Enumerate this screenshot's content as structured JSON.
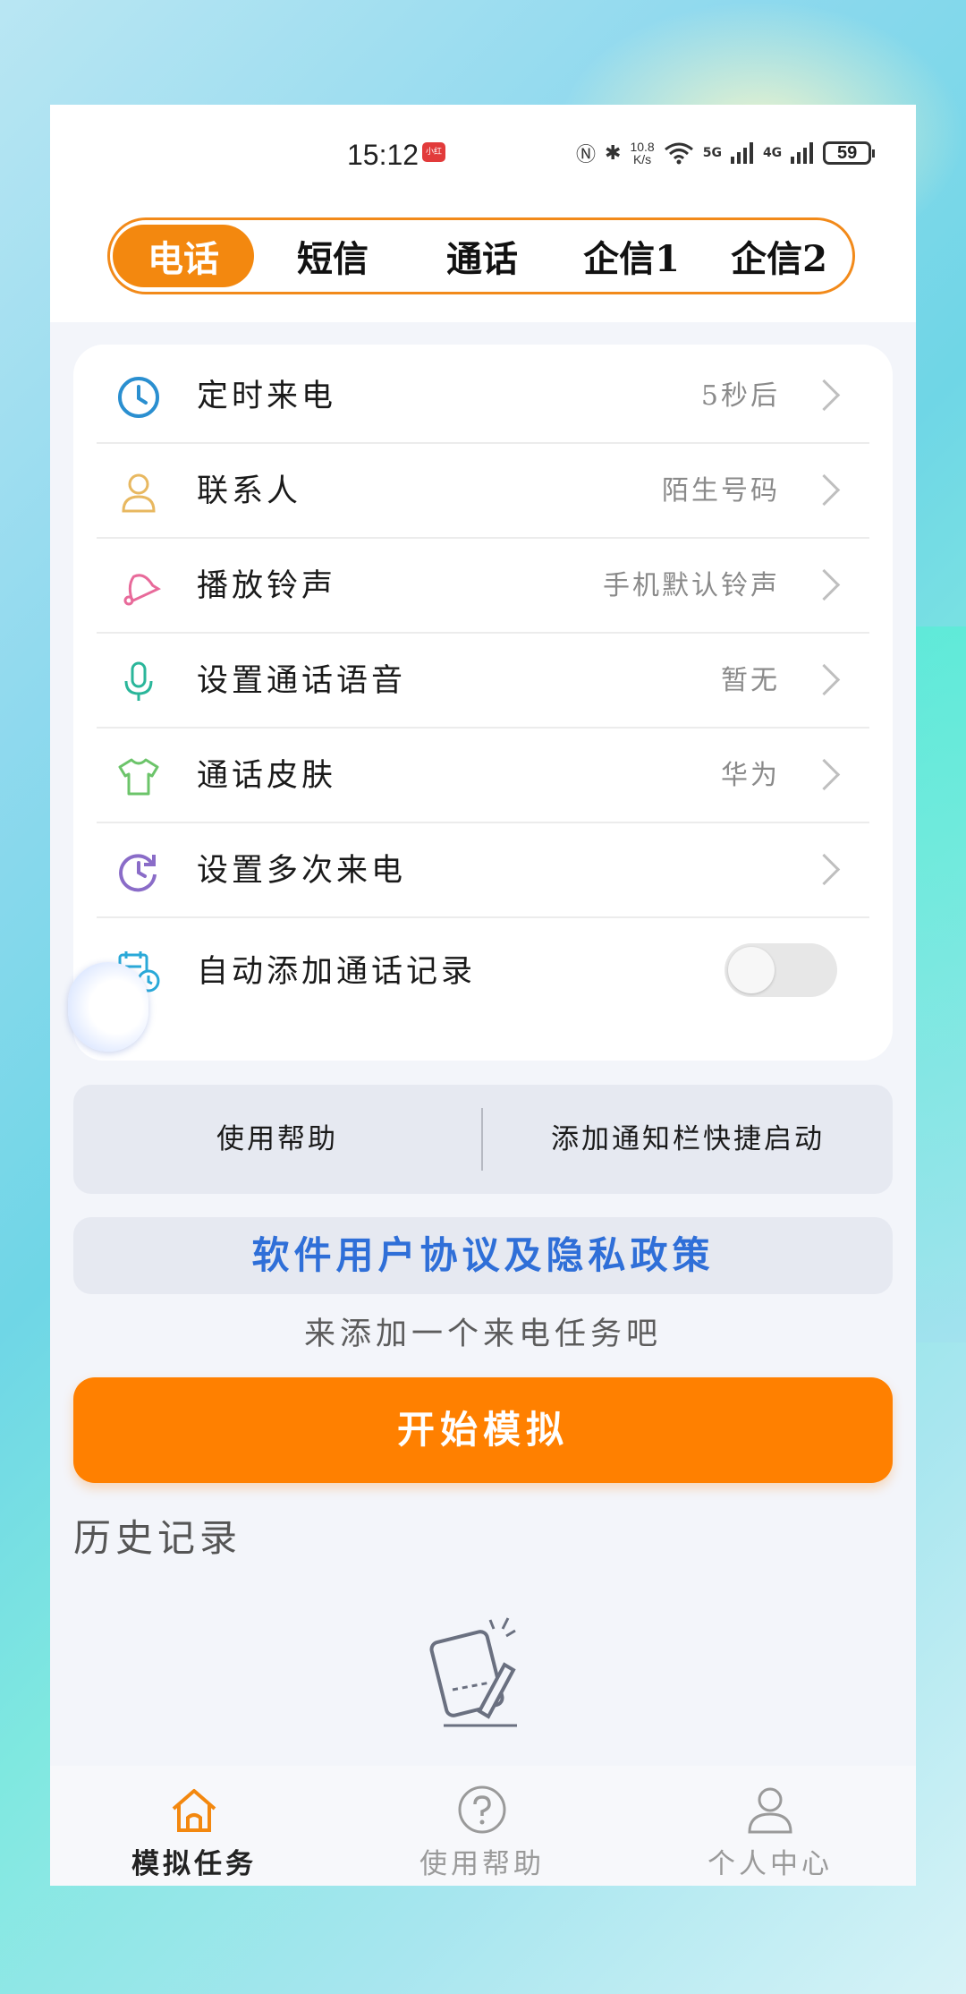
{
  "status_bar": {
    "time": "15:12",
    "badge": "小红书",
    "speed_top": "10.8",
    "speed_unit": "K/s",
    "network_1": "5G",
    "network_2": "4G",
    "battery": "59"
  },
  "tabs": [
    {
      "label": "电话",
      "active": true
    },
    {
      "label": "短信",
      "active": false
    },
    {
      "label": "通话",
      "active": false
    },
    {
      "label": "企信1",
      "active": false
    },
    {
      "label": "企信2",
      "active": false
    }
  ],
  "settings": [
    {
      "label": "定时来电",
      "value": "5秒后",
      "icon": "clock-icon",
      "color": "#2a8fd0"
    },
    {
      "label": "联系人",
      "value": "陌生号码",
      "icon": "person-icon",
      "color": "#e8b860"
    },
    {
      "label": "播放铃声",
      "value": "手机默认铃声",
      "icon": "bell-icon",
      "color": "#e86a9a"
    },
    {
      "label": "设置通话语音",
      "value": "暂无",
      "icon": "microphone-icon",
      "color": "#2ab69a"
    },
    {
      "label": "通话皮肤",
      "value": "华为",
      "icon": "shirt-icon",
      "color": "#6cc46a"
    },
    {
      "label": "设置多次来电",
      "value": "",
      "icon": "repeat-clock-icon",
      "color": "#8a6cc8"
    },
    {
      "label": "自动添加通话记录",
      "toggle_on": false,
      "icon": "calendar-clock-icon",
      "color": "#2aa9d8"
    }
  ],
  "help_bar": {
    "left": "使用帮助",
    "right": "添加通知栏快捷启动"
  },
  "policy_link": "软件用户协议及隐私政策",
  "hint": "来添加一个来电任务吧",
  "start_button": "开始模拟",
  "history_title": "历史记录",
  "bottom_nav": [
    {
      "label": "模拟任务",
      "icon": "home-icon",
      "active": true
    },
    {
      "label": "使用帮助",
      "icon": "help-circle-icon",
      "active": false
    },
    {
      "label": "个人中心",
      "icon": "user-icon",
      "active": false
    }
  ],
  "colors": {
    "accent": "#ff8000",
    "tab_active": "#f3880f",
    "link": "#2f6fd8"
  }
}
